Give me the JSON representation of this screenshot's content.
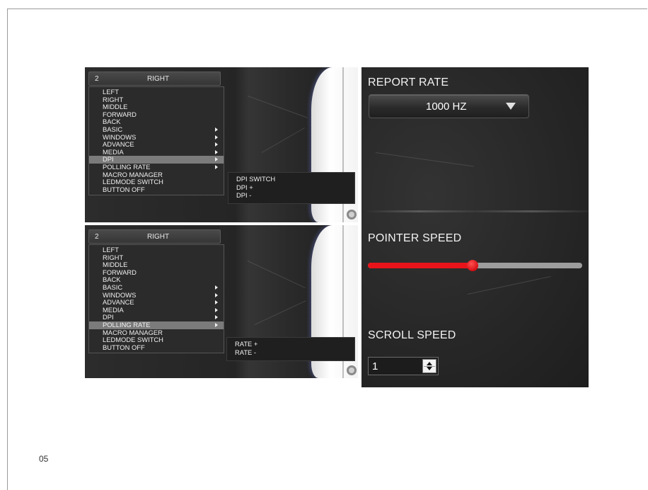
{
  "page": {
    "number": "05"
  },
  "top_panel": {
    "button_number": "2",
    "button_value": "RIGHT",
    "menu_items": [
      {
        "label": "LEFT",
        "has_submenu": false,
        "active": false
      },
      {
        "label": "RIGHT",
        "has_submenu": false,
        "active": false
      },
      {
        "label": "MIDDLE",
        "has_submenu": false,
        "active": false
      },
      {
        "label": "FORWARD",
        "has_submenu": false,
        "active": false
      },
      {
        "label": "BACK",
        "has_submenu": false,
        "active": false
      },
      {
        "label": "BASIC",
        "has_submenu": true,
        "active": false
      },
      {
        "label": "WINDOWS",
        "has_submenu": true,
        "active": false
      },
      {
        "label": "ADVANCE",
        "has_submenu": true,
        "active": false
      },
      {
        "label": "MEDIA",
        "has_submenu": true,
        "active": false
      },
      {
        "label": "DPI",
        "has_submenu": true,
        "active": true
      },
      {
        "label": "POLLING RATE",
        "has_submenu": true,
        "active": false
      },
      {
        "label": "MACRO MANAGER",
        "has_submenu": false,
        "active": false
      },
      {
        "label": "LEDMODE SWITCH",
        "has_submenu": false,
        "active": false
      },
      {
        "label": "BUTTON OFF",
        "has_submenu": false,
        "active": false
      }
    ],
    "submenu": [
      "DPI SWITCH",
      "DPI +",
      "DPI -"
    ]
  },
  "bottom_panel": {
    "button_number": "2",
    "button_value": "RIGHT",
    "menu_items": [
      {
        "label": "LEFT",
        "has_submenu": false,
        "active": false
      },
      {
        "label": "RIGHT",
        "has_submenu": false,
        "active": false
      },
      {
        "label": "MIDDLE",
        "has_submenu": false,
        "active": false
      },
      {
        "label": "FORWARD",
        "has_submenu": false,
        "active": false
      },
      {
        "label": "BACK",
        "has_submenu": false,
        "active": false
      },
      {
        "label": "BASIC",
        "has_submenu": true,
        "active": false
      },
      {
        "label": "WINDOWS",
        "has_submenu": true,
        "active": false
      },
      {
        "label": "ADVANCE",
        "has_submenu": true,
        "active": false
      },
      {
        "label": "MEDIA",
        "has_submenu": true,
        "active": false
      },
      {
        "label": "DPI",
        "has_submenu": true,
        "active": false
      },
      {
        "label": "POLLING RATE",
        "has_submenu": true,
        "active": true
      },
      {
        "label": "MACRO MANAGER",
        "has_submenu": false,
        "active": false
      },
      {
        "label": "LEDMODE SWITCH",
        "has_submenu": false,
        "active": false
      },
      {
        "label": "BUTTON OFF",
        "has_submenu": false,
        "active": false
      }
    ],
    "submenu": [
      "RATE +",
      "RATE -"
    ]
  },
  "settings": {
    "report_rate": {
      "title": "REPORT RATE",
      "value": "1000 HZ"
    },
    "pointer_speed": {
      "title": "POINTER SPEED",
      "level": 0.49
    },
    "scroll_speed": {
      "title": "SCROLL SPEED",
      "value": "1"
    }
  },
  "colors": {
    "accent_red": "#e8141a",
    "menu_highlight": "#7b7b7b",
    "panel_bg": "#2b2b2b"
  }
}
